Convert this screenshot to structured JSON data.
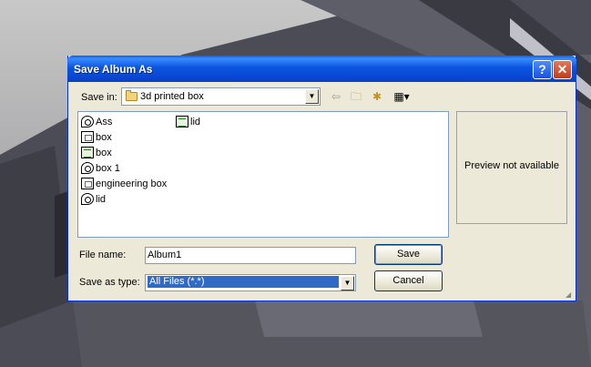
{
  "dialog": {
    "title": "Save Album As",
    "help_glyph": "?",
    "close_glyph": "✕"
  },
  "toolbar": {
    "save_in_label": "Save in:",
    "save_in_value": "3d printed box",
    "back_icon": "back-arrow-icon",
    "up_icon": "up-one-level-icon",
    "new_folder_icon": "new-folder-icon",
    "views_icon": "views-menu-icon"
  },
  "files": [
    {
      "name": "Ass",
      "icon": "assembly-icon"
    },
    {
      "name": "box",
      "icon": "drawing-icon"
    },
    {
      "name": "box",
      "icon": "part-icon"
    },
    {
      "name": "box 1",
      "icon": "assembly-icon"
    },
    {
      "name": "engineering box",
      "icon": "drawing-icon"
    },
    {
      "name": "lid",
      "icon": "assembly-icon"
    },
    {
      "name": "lid",
      "icon": "part-icon"
    }
  ],
  "preview": {
    "text": "Preview not available"
  },
  "form": {
    "file_name_label": "File name:",
    "file_name_value": "Album1",
    "save_as_type_label": "Save as type:",
    "save_as_type_value": "All Files (*.*)"
  },
  "buttons": {
    "save": "Save",
    "cancel": "Cancel"
  },
  "colors": {
    "titlebar": "#0a55e0",
    "selection": "#316ac5",
    "dialog_bg": "#ece9d8"
  }
}
